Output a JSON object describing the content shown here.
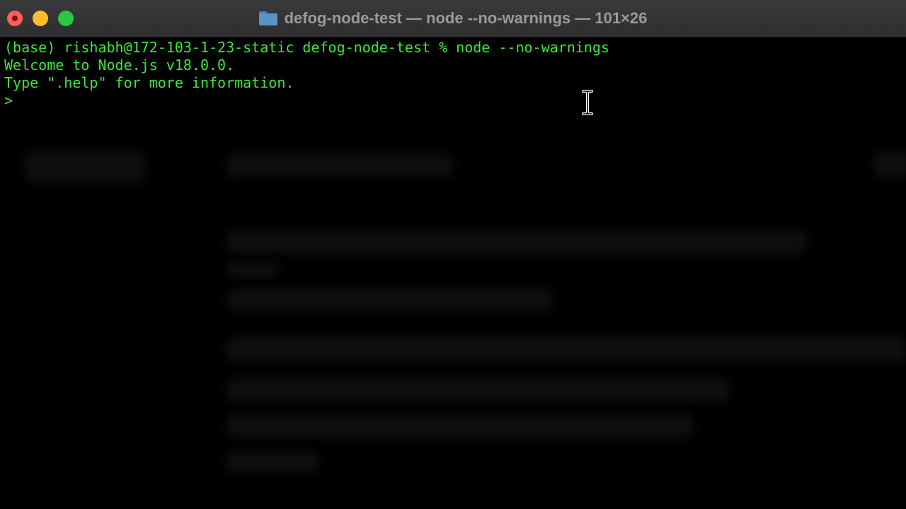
{
  "window": {
    "title": "defog-node-test — node --no-warnings — 101×26",
    "controls": [
      "close",
      "minimize",
      "zoom"
    ]
  },
  "terminal": {
    "text_color": "#3de63d",
    "background": "#000000",
    "lines": [
      "(base) rishabh@172-103-1-23-static defog-node-test % node --no-warnings",
      "Welcome to Node.js v18.0.0.",
      "Type \".help\" for more information.",
      ">"
    ]
  },
  "icons": {
    "folder": "folder-icon",
    "text_cursor": "ibeam-cursor-icon"
  }
}
